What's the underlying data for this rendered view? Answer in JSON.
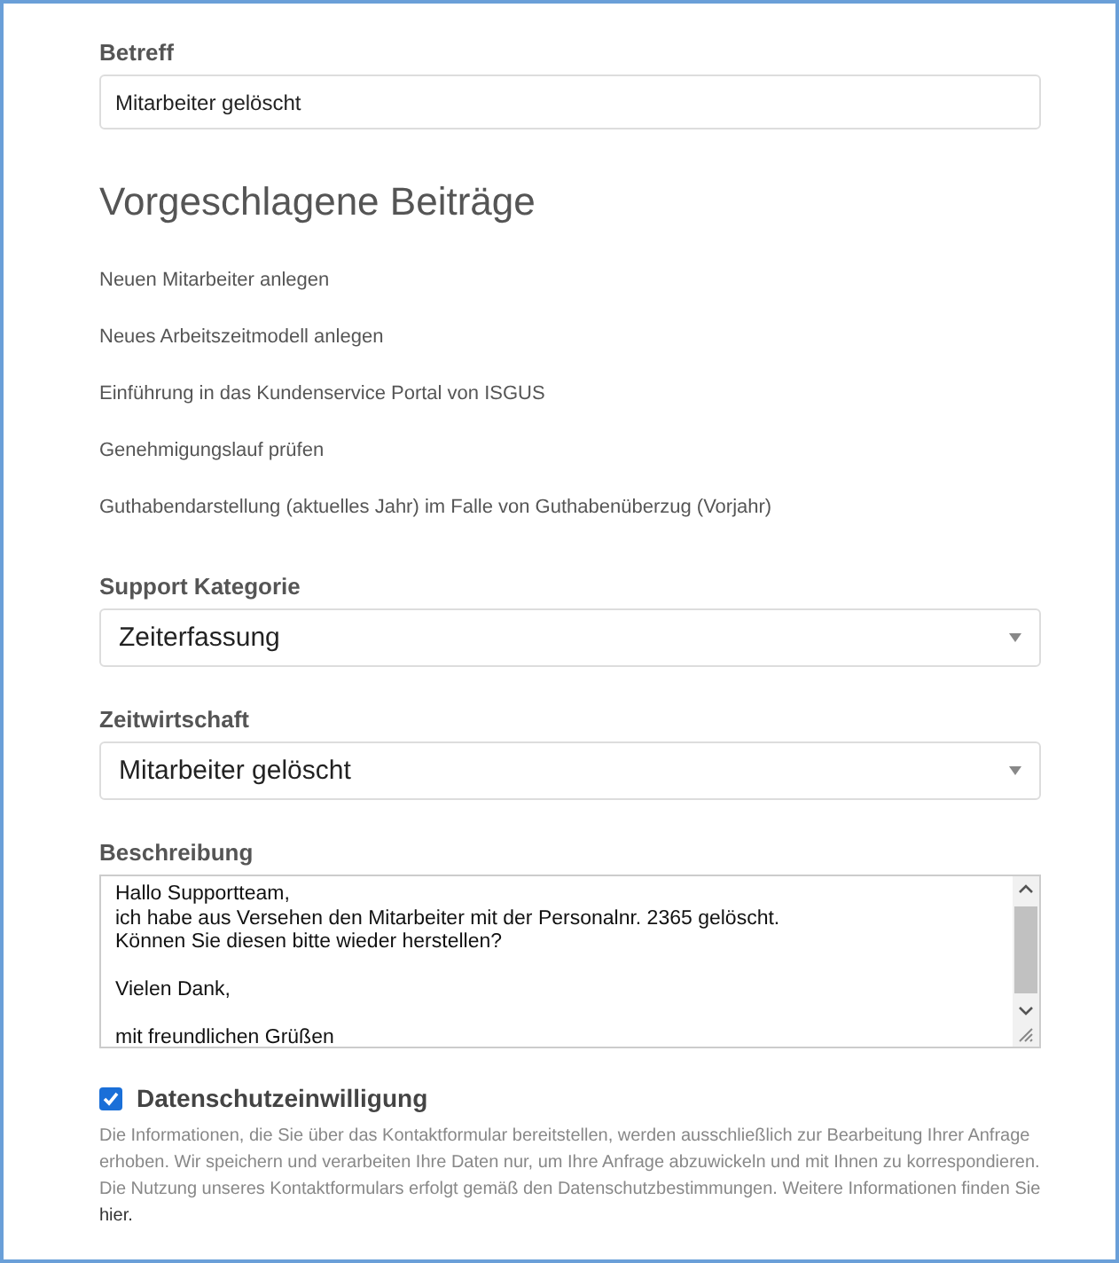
{
  "subject": {
    "label": "Betreff",
    "value": "Mitarbeiter gelöscht"
  },
  "suggestions": {
    "title": "Vorgeschlagene Beiträge",
    "items": [
      "Neuen Mitarbeiter anlegen",
      "Neues Arbeitszeitmodell anlegen",
      "Einführung in das Kundenservice Portal von ISGUS",
      "Genehmigungslauf prüfen",
      "Guthabendarstellung (aktuelles Jahr) im Falle von Guthabenüberzug (Vorjahr)"
    ]
  },
  "selects": [
    {
      "label": "Support Kategorie",
      "value": "Zeiterfassung"
    },
    {
      "label": "Zeitwirtschaft",
      "value": "Mitarbeiter gelöscht"
    }
  ],
  "description": {
    "label": "Beschreibung",
    "value": "Hallo Supportteam,\nich habe aus Versehen den Mitarbeiter mit der Personalnr. 2365 gelöscht.\nKönnen Sie diesen bitte wieder herstellen?\n\nVielen Dank,\n\nmit freundlichen Grüßen"
  },
  "consent": {
    "label": "Datenschutzeinwilligung",
    "checked": true,
    "text": "Die Informationen, die Sie über das Kontaktformular bereitstellen, werden ausschließlich zur Bearbeitung Ihrer Anfrage erhoben. Wir speichern und verarbeiten Ihre Daten nur, um Ihre Anfrage abzuwickeln und mit Ihnen zu korrespondieren. Die Nutzung unseres Kontaktformulars erfolgt gemäß den Datenschutzbestimmungen. Weitere Informationen finden Sie ",
    "link": "hier."
  }
}
